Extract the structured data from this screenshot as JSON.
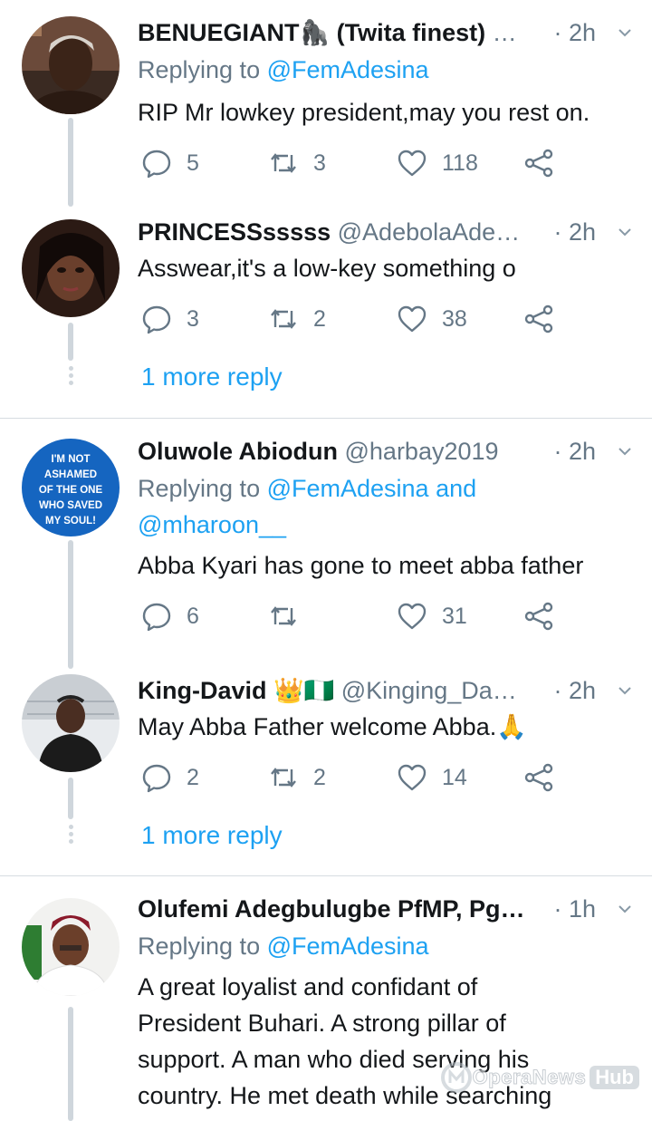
{
  "colors": {
    "link": "#1da1f2",
    "secondary_text": "#657786",
    "primary_text": "#14171a",
    "thread_line": "#cfd6dc",
    "divider": "#d6dce1"
  },
  "tweets": [
    {
      "name": "BENUEGIANT🦍 (Twita finest)",
      "handle": "…",
      "time": "· 2h",
      "reply_prefix": "Replying to ",
      "reply_to": "@FemAdesina",
      "text": "RIP Mr lowkey president,may you rest on.",
      "replies": "5",
      "retweets": "3",
      "likes": "118"
    },
    {
      "name": "PRINCESSsssss",
      "handle": "@AdebolaAde…",
      "time": "· 2h",
      "text": "Asswear,it's a low-key something o",
      "replies": "3",
      "retweets": "2",
      "likes": "38",
      "more_reply": "1 more reply"
    },
    {
      "name": "Oluwole Abiodun",
      "handle": "@harbay2019",
      "time": "· 2h",
      "reply_prefix": "Replying to ",
      "reply_to": "@FemAdesina and",
      "reply_to_2": "@mharoon__",
      "text": "Abba Kyari has gone to meet abba father",
      "replies": "6",
      "retweets": "",
      "likes": "31",
      "avatar_text": [
        "I'M NOT",
        "ASHAMED",
        "OF THE ONE",
        "WHO SAVED",
        "MY SOUL!"
      ]
    },
    {
      "name": "King-David 👑🇳🇬",
      "handle": "@Kinging_Da…",
      "time": "· 2h",
      "text": "May Abba Father welcome Abba.🙏",
      "replies": "2",
      "retweets": "2",
      "likes": "14",
      "more_reply": "1 more reply"
    },
    {
      "name": "Olufemi Adegbulugbe PfMP, Pg…",
      "handle": "",
      "time": "· 1h",
      "reply_prefix": "Replying to ",
      "reply_to": "@FemAdesina",
      "text_lines": [
        "A great loyalist and confidant of",
        "President Buhari. A strong pillar of",
        "support. A man who died serving his",
        "country. He met death while searching"
      ]
    }
  ],
  "watermark": {
    "text": "OperaNews",
    "hub": "Hub"
  }
}
